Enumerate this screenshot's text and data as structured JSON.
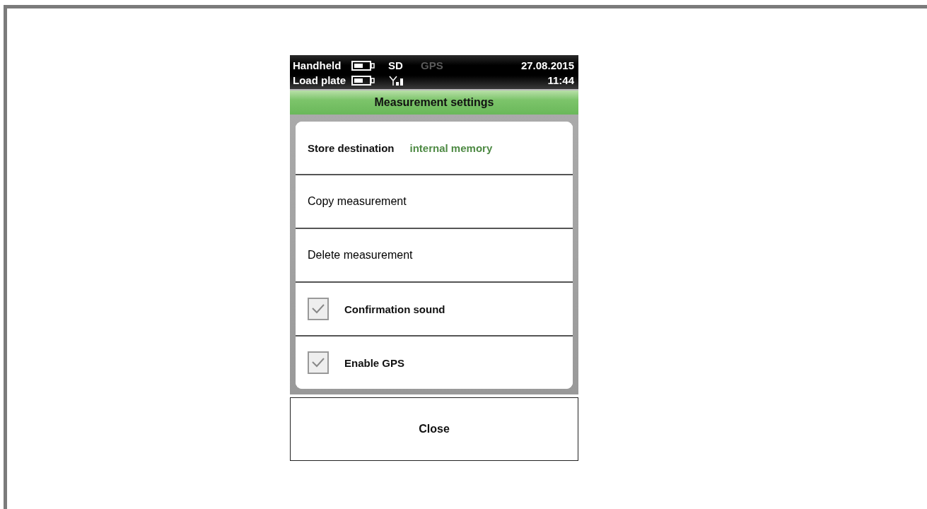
{
  "status_bar": {
    "device_label": "Handheld",
    "sd": {
      "label": "SD",
      "active": true
    },
    "gps": {
      "label": "GPS",
      "active": false
    },
    "date": "27.08.2015",
    "plate_label": "Load plate",
    "time": "11:44"
  },
  "title": "Measurement settings",
  "items": [
    {
      "kind": "value",
      "label": "Store destination",
      "value": "internal memory"
    },
    {
      "kind": "action",
      "label": "Copy measurement"
    },
    {
      "kind": "action",
      "label": "Delete measurement"
    },
    {
      "kind": "checkbox",
      "label": "Confirmation sound",
      "checked": true
    },
    {
      "kind": "checkbox",
      "label": "Enable GPS",
      "checked": true
    }
  ],
  "close_button": "Close"
}
